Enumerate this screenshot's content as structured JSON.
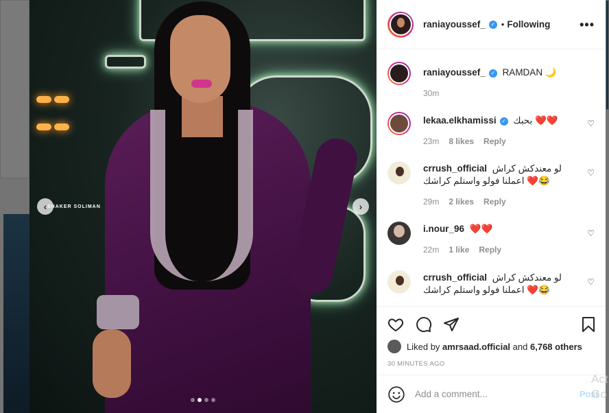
{
  "post": {
    "photo_credit": "SHAKER SOLIMAN",
    "carousel": {
      "total": 4,
      "active": 1
    }
  },
  "header": {
    "username": "raniayoussef_",
    "separator": "•",
    "follow_status": "Following",
    "more": "•••"
  },
  "caption": {
    "username": "raniayoussef_",
    "text": "RAMDAN 🌙",
    "time": "30m"
  },
  "comments": [
    {
      "username": "lekaa.elkhamissi",
      "verified": true,
      "text": "بحبك ❤️❤️",
      "time": "23m",
      "likes": "8 likes",
      "reply": "Reply"
    },
    {
      "username": "crrush_official",
      "verified": false,
      "text": "لو معندكش كراش اعملنا فولو واستلم كراشك ❤️😂",
      "time": "29m",
      "likes": "2 likes",
      "reply": "Reply"
    },
    {
      "username": "i.nour_96",
      "verified": false,
      "text": "❤️❤️",
      "time": "22m",
      "likes": "1 like",
      "reply": "Reply"
    },
    {
      "username": "crrush_official",
      "verified": false,
      "text": "لو معندكش كراش اعملنا فولو واستلم كراشك ❤️😂"
    }
  ],
  "likes": {
    "prefix": "Liked by",
    "user": "amrsaad.official",
    "joiner": "and",
    "others": "6,768 others"
  },
  "timestamp": "30 MINUTES AGO",
  "add_comment": {
    "placeholder": "Add a comment...",
    "post_label": "Post"
  },
  "watermark": {
    "line1": "Act",
    "line2": "Go"
  },
  "icons": [
    "heart-icon",
    "comment-icon",
    "share-icon",
    "bookmark-icon",
    "emoji-icon",
    "more-options-icon",
    "verified-icon"
  ],
  "colors": {
    "verified": "#3897f0",
    "post_button": "#b2dffc",
    "meta": "#8e8e8e"
  }
}
